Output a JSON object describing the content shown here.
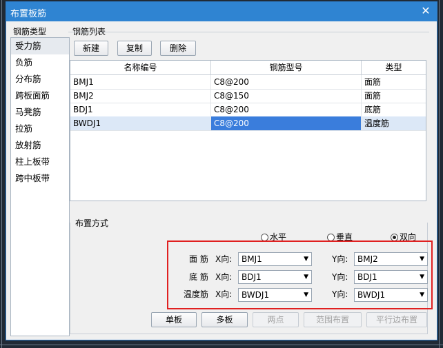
{
  "dialog": {
    "title": "布置板筋",
    "close_glyph": "✕"
  },
  "left": {
    "group_label": "钢筋类型",
    "items": [
      "受力筋",
      "负筋",
      "分布筋",
      "跨板面筋",
      "马凳筋",
      "拉筋",
      "放射筋",
      "柱上板带",
      "跨中板带"
    ],
    "selected_index": 0
  },
  "list": {
    "group_label": "钢筋列表",
    "buttons": {
      "new": "新建",
      "copy": "复制",
      "delete": "删除"
    },
    "columns": [
      "名称编号",
      "钢筋型号",
      "类型"
    ],
    "rows": [
      [
        "BMJ1",
        "C8@200",
        "面筋"
      ],
      [
        "BMJ2",
        "C8@150",
        "面筋"
      ],
      [
        "BDJ1",
        "C8@200",
        "底筋"
      ],
      [
        "BWDJ1",
        "C8@200",
        "温度筋"
      ]
    ],
    "selected_row": 3
  },
  "layout": {
    "group_label": "布置方式",
    "radios": {
      "horizontal": "水平",
      "vertical": "垂直",
      "both": "双向"
    },
    "radio_selected": "both",
    "rows": [
      {
        "label": "面 筋",
        "x_label": "X向:",
        "x_value": "BMJ1",
        "y_label": "Y向:",
        "y_value": "BMJ2"
      },
      {
        "label": "底 筋",
        "x_label": "X向:",
        "x_value": "BDJ1",
        "y_label": "Y向:",
        "y_value": "BDJ1"
      },
      {
        "label": "温度筋",
        "x_label": "X向:",
        "x_value": "BWDJ1",
        "y_label": "Y向:",
        "y_value": "BWDJ1"
      }
    ],
    "buttons": {
      "single": "单板",
      "multi": "多板",
      "two_point": "两点",
      "range": "范围布置",
      "parallel": "平行边布置"
    }
  },
  "colors": {
    "title_bar": "#2f84d2",
    "highlight": "#e02020",
    "selection": "#3a7ddc"
  }
}
